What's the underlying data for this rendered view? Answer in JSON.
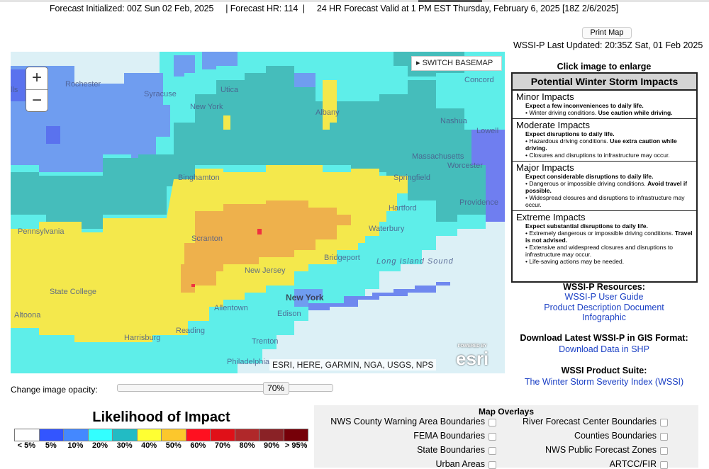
{
  "header": {
    "forecast_line": "Forecast Initialized: 00Z Sun 02 Feb, 2025     | Forecast HR: 114  |     24 HR Forecast Valid at 1 PM EST Thursday, February 6, 2025 [18Z 2/6/2025]",
    "print_label": "Print Map",
    "last_updated": "WSSI-P Last Updated: 20:35Z Sat, 01 Feb 2025"
  },
  "map": {
    "zoom_in": "+",
    "zoom_out": "−",
    "switch_basemap": "▸ SWITCH BASEMAP",
    "attribution": "ESRI, HERE, GARMIN, NGA, USGS, NPS",
    "esri_powered": "POWERED BY",
    "esri_logo": "esri",
    "labels": {
      "rochester": "Rochester",
      "syracuse": "Syracuse",
      "utica": "Utica",
      "newyork_state": "New York",
      "albany": "Albany",
      "concord": "Concord",
      "nashua": "Nashua",
      "lowell": "Lowell",
      "worcester": "Worcester",
      "massachusetts": "Massachusetts",
      "binghamton": "Binghamton",
      "springfield": "Springfield",
      "hartford": "Hartford",
      "providence": "Providence",
      "pennsylvania": "Pennsylvania",
      "scranton": "Scranton",
      "waterbury": "Waterbury",
      "bridgeport": "Bridgeport",
      "long_island_sound": "Long Island Sound",
      "new_jersey": "New Jersey",
      "state_college": "State College",
      "allentown": "Allentown",
      "new_york_city": "New York",
      "edison": "Edison",
      "altoona": "Altoona",
      "harrisburg": "Harrisburg",
      "reading": "Reading",
      "trenton": "Trenton",
      "philadelphia": "Philadelphia",
      "falls": "lls"
    }
  },
  "impacts": {
    "click_label": "Click image to enlarge",
    "title": "Potential Winter Storm Impacts",
    "sections": [
      {
        "title": "Minor Impacts",
        "sub": "Expect a few inconveniences to daily life.",
        "bullets": [
          {
            "text": "• Winter driving conditions. ",
            "bold": "Use caution while driving."
          }
        ]
      },
      {
        "title": "Moderate Impacts",
        "sub": "Expect disruptions to daily life.",
        "bullets": [
          {
            "text": "• Hazardous driving conditions. ",
            "bold": "Use extra caution while driving."
          },
          {
            "text": "• Closures and disruptions to infrastructure may occur.",
            "bold": ""
          }
        ]
      },
      {
        "title": "Major Impacts",
        "sub": "Expect considerable disruptions to daily life.",
        "bullets": [
          {
            "text": "• Dangerous or impossible driving conditions. ",
            "bold": "Avoid travel if possible."
          },
          {
            "text": "• Widespread closures and disruptions to infrastructure may occur.",
            "bold": ""
          }
        ]
      },
      {
        "title": "Extreme Impacts",
        "sub": "Expect substantial disruptions to daily life.",
        "bullets": [
          {
            "text": "• Extremely dangerous or impossible driving conditions. ",
            "bold": "Travel is not advised."
          },
          {
            "text": "• Extensive and widespread closures and disruptions to infrastructure may occur.",
            "bold": ""
          },
          {
            "text": "• Life-saving actions may be needed.",
            "bold": ""
          }
        ]
      }
    ]
  },
  "resources": {
    "heading": "WSSI-P Resources:",
    "links": [
      "WSSI-P User Guide",
      "Product Description Document",
      "Infographic"
    ],
    "gis_heading": "Download Latest WSSI-P in GIS Format:",
    "gis_link": "Download Data in SHP",
    "suite_heading": "WSSI Product Suite:",
    "suite_link": "The Winter Storm Severity Index (WSSI)"
  },
  "opacity": {
    "label": "Change image opacity:",
    "value": "70%",
    "fraction": 0.7
  },
  "legend": {
    "title": "Likelihood of Impact",
    "items": [
      {
        "label": "< 5%",
        "color": "#ffffff"
      },
      {
        "label": "5%",
        "color": "#3355ff"
      },
      {
        "label": "10%",
        "color": "#4488ff"
      },
      {
        "label": "20%",
        "color": "#33ffff"
      },
      {
        "label": "30%",
        "color": "#22bbc4"
      },
      {
        "label": "40%",
        "color": "#ffff33"
      },
      {
        "label": "50%",
        "color": "#fcc72c"
      },
      {
        "label": "60%",
        "color": "#ff1020"
      },
      {
        "label": "70%",
        "color": "#e01018"
      },
      {
        "label": "80%",
        "color": "#b0282a"
      },
      {
        "label": "90%",
        "color": "#8a2226"
      },
      {
        "label": "> 95%",
        "color": "#760008"
      }
    ]
  },
  "overlays": {
    "title": "Map Overlays",
    "left": [
      {
        "label": "NWS County Warning Area Boundaries",
        "checked": false
      },
      {
        "label": "FEMA Boundaries",
        "checked": false
      },
      {
        "label": "State Boundaries",
        "checked": false
      },
      {
        "label": "Urban Areas",
        "checked": false
      }
    ],
    "right": [
      {
        "label": "River Forecast Center Boundaries",
        "checked": false
      },
      {
        "label": "Counties Boundaries",
        "checked": false
      },
      {
        "label": "NWS Public Forecast Zones",
        "checked": false
      },
      {
        "label": "ARTCC/FIR",
        "checked": false
      }
    ]
  }
}
